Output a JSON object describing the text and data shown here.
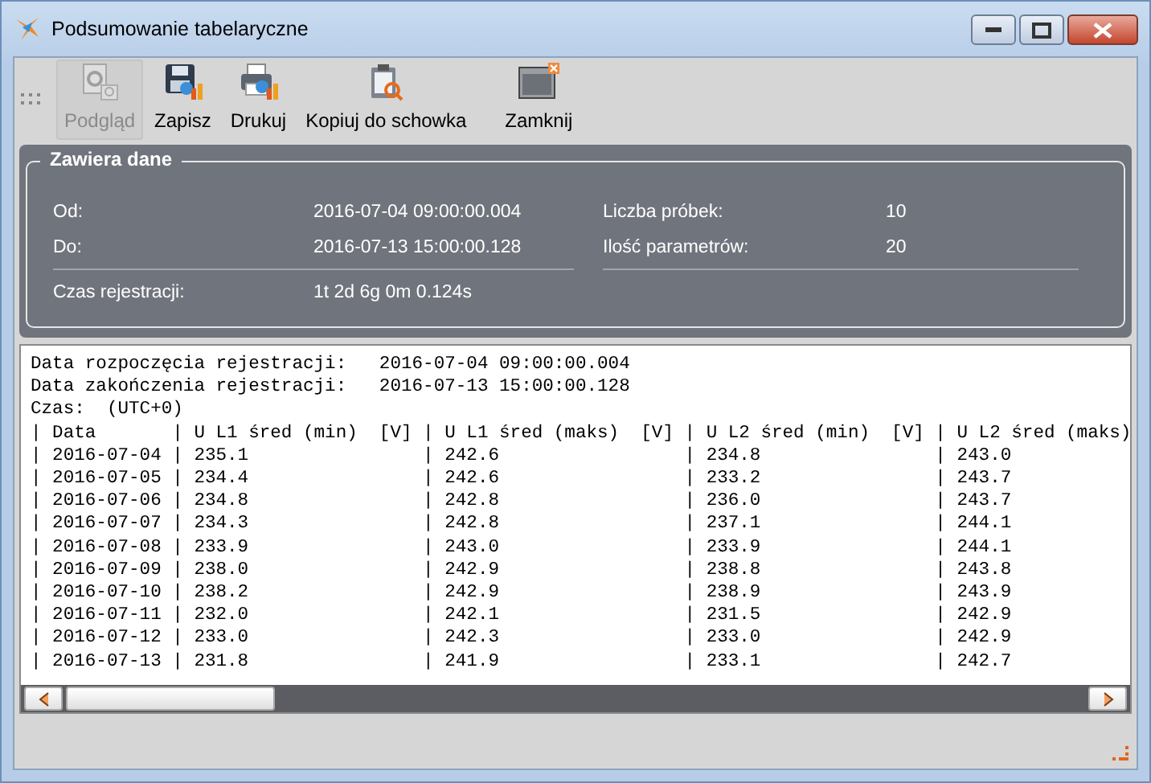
{
  "window": {
    "title": "Podsumowanie tabelaryczne"
  },
  "toolbar": [
    {
      "label": "Podgląd",
      "disabled": true,
      "selected": true
    },
    {
      "label": "Zapisz",
      "disabled": false,
      "selected": false
    },
    {
      "label": "Drukuj",
      "disabled": false,
      "selected": false
    },
    {
      "label": "Kopiuj do schowka",
      "disabled": false,
      "selected": false
    },
    {
      "label": "Zamknij",
      "disabled": false,
      "selected": false
    }
  ],
  "info": {
    "title": "Zawiera dane",
    "left": [
      {
        "label": "Od:",
        "value": "2016-07-04 09:00:00.004"
      },
      {
        "label": "Do:",
        "value": "2016-07-13 15:00:00.128"
      }
    ],
    "right": [
      {
        "label": "Liczba próbek:",
        "value": "10"
      },
      {
        "label": "Ilość parametrów:",
        "value": "20"
      }
    ],
    "duration": {
      "label": "Czas rejestracji:",
      "value": "1t 2d 6g 0m 0.124s"
    }
  },
  "report": {
    "lines": [
      "Data rozpoczęcia rejestracji:   2016-07-04 09:00:00.004",
      "Data zakończenia rejestracji:   2016-07-13 15:00:00.128",
      "Czas:  (UTC+0)",
      "| Data       | U L1 śred (min)  [V] | U L1 śred (maks)  [V] | U L2 śred (min)  [V] | U L2 śred (maks)",
      "| 2016-07-04 | 235.1                | 242.6                 | 234.8                | 243.0",
      "| 2016-07-05 | 234.4                | 242.6                 | 233.2                | 243.7",
      "| 2016-07-06 | 234.8                | 242.8                 | 236.0                | 243.7",
      "| 2016-07-07 | 234.3                | 242.8                 | 237.1                | 244.1",
      "| 2016-07-08 | 233.9                | 243.0                 | 233.9                | 244.1",
      "| 2016-07-09 | 238.0                | 242.9                 | 238.8                | 243.8",
      "| 2016-07-10 | 238.2                | 242.9                 | 238.9                | 243.9",
      "| 2016-07-11 | 232.0                | 242.1                 | 231.5                | 242.9",
      "| 2016-07-12 | 233.0                | 242.3                 | 233.0                | 242.9",
      "| 2016-07-13 | 231.8                | 241.9                 | 233.1                | 242.7"
    ]
  }
}
